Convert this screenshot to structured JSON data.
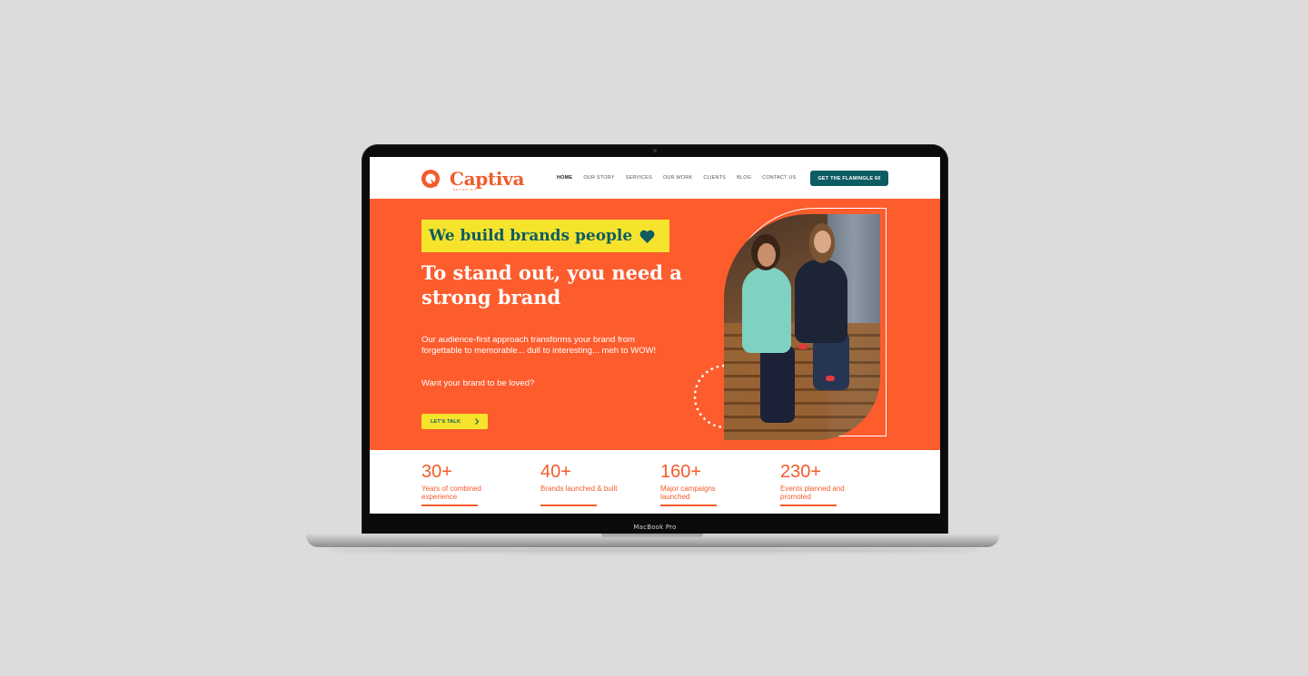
{
  "device": {
    "label": "MacBook Pro"
  },
  "site": {
    "brand": {
      "name": "Captiva",
      "subtitle": "BRANDING"
    },
    "nav": [
      {
        "label": "HOME",
        "active": true
      },
      {
        "label": "OUR STORY",
        "active": false
      },
      {
        "label": "SERVICES",
        "active": false
      },
      {
        "label": "OUR WORK",
        "active": false
      },
      {
        "label": "CLIENTS",
        "active": false
      },
      {
        "label": "BLOG",
        "active": false
      },
      {
        "label": "CONTACT US",
        "active": false
      }
    ],
    "header_cta": "GET THE FLAMINGLE 60",
    "hero": {
      "badge": "We build brands people",
      "badge_icon": "heart-icon",
      "title": "To stand out, you need a strong brand",
      "body": "Our audience-first approach transforms your brand from forgettable to memorable... dull to interesting... meh to WOW!",
      "question": "Want your brand to be loved?",
      "cta": "LET'S TALK"
    },
    "stats": [
      {
        "number": "30+",
        "label": "Years of combined experience"
      },
      {
        "number": "40+",
        "label": "Brands launched & built"
      },
      {
        "number": "160+",
        "label": "Major campaigns launched"
      },
      {
        "number": "230+",
        "label": "Events planned and promoted"
      }
    ]
  },
  "colors": {
    "orange": "#fd5c2d",
    "teal": "#0e5c63",
    "yellow": "#f6e32c",
    "background": "#dcdcdc"
  }
}
